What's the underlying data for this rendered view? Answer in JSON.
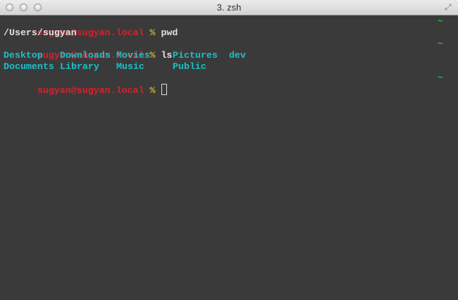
{
  "window": {
    "title": "3. zsh"
  },
  "terminal": {
    "prompt_user": "sugyan@sugyan.local",
    "prompt_symbol": "%",
    "right_prompt": "~",
    "lines": [
      {
        "command": "pwd"
      },
      {
        "output": "/Users/sugyan"
      },
      {
        "command": "ls"
      }
    ],
    "ls_rows": [
      [
        "Desktop",
        "Downloads",
        "Movies",
        "Pictures",
        "dev"
      ],
      [
        "Documents",
        "Library",
        "Music",
        "Public"
      ]
    ]
  },
  "colors": {
    "user": "#d4222e",
    "symbol": "#c8b43a",
    "directory": "#1cc0c8",
    "right_prompt": "#2db83d",
    "background": "#3a3a3a"
  }
}
